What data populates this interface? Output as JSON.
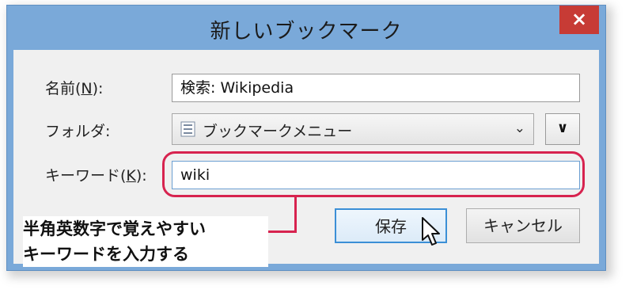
{
  "dialog": {
    "title": "新しいブックマーク",
    "close_label": "×"
  },
  "form": {
    "name_label": "名前(",
    "name_key": "N",
    "name_suffix": "):",
    "name_value": "検索: Wikipedia",
    "folder_label": "フォルダ:",
    "folder_value": "ブックマークメニュー",
    "folder_icon": "bookmark-menu-icon",
    "folder_dropdown_icon": "chevron-down-icon",
    "expand_icon": "chevron-down-icon",
    "keyword_label": "キーワード(",
    "keyword_key": "K",
    "keyword_suffix": "):",
    "keyword_value": "wiki"
  },
  "buttons": {
    "save_label": "保存",
    "cancel_label": "キャンセル"
  },
  "annotation": {
    "line1": "半角英数字で覚えやすい",
    "line2": "キーワードを入力する",
    "color": "#d7234f"
  },
  "colors": {
    "titlebar": "#7aa9d9",
    "close": "#c73b35",
    "highlight": "#d7234f"
  }
}
